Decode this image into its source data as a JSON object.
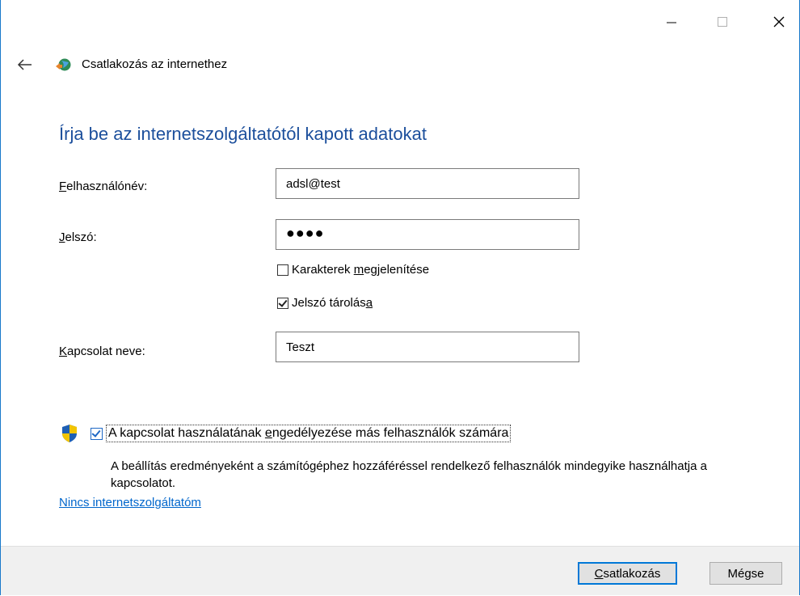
{
  "window": {
    "app_title": "Csatlakozás az internethez",
    "minimize_glyph": "—",
    "maximize_glyph": "☐",
    "close_glyph": "✕"
  },
  "form": {
    "heading": "Írja be az internetszolgáltatótól kapott adatokat",
    "username": {
      "label_first": "F",
      "label_rest": "elhasználónév:",
      "value": "adsl@test"
    },
    "password": {
      "label_first": "J",
      "label_rest": "elszó:",
      "value": "●●●●"
    },
    "show_chars": {
      "before": "Karakterek ",
      "underlined": "m",
      "after": "egjelenítése",
      "checked": false
    },
    "save_password": {
      "before": "Jelszó tárolás",
      "underlined": "a",
      "after": "",
      "checked": true
    },
    "connection_name": {
      "label_first": "K",
      "label_rest": "apcsolat neve:",
      "value": "Teszt"
    }
  },
  "sharing": {
    "label_before": "A kapcsolat használatának ",
    "label_underlined": "e",
    "label_after": "ngedélyezése más felhasználók számára",
    "checked": true,
    "description": "A beállítás eredményeként a számítógéphez hozzáféréssel rendelkező felhasználók mindegyike használhatja a kapcsolatot."
  },
  "links": {
    "no_isp": "Nincs internetszolgáltatóm"
  },
  "buttons": {
    "connect_first": "C",
    "connect_rest": "satlakozás",
    "cancel": "Mégse"
  },
  "colors": {
    "heading": "#1c4f9c",
    "link": "#0066cc",
    "accent": "#0078d7",
    "footer_bg": "#f0f0f0"
  }
}
